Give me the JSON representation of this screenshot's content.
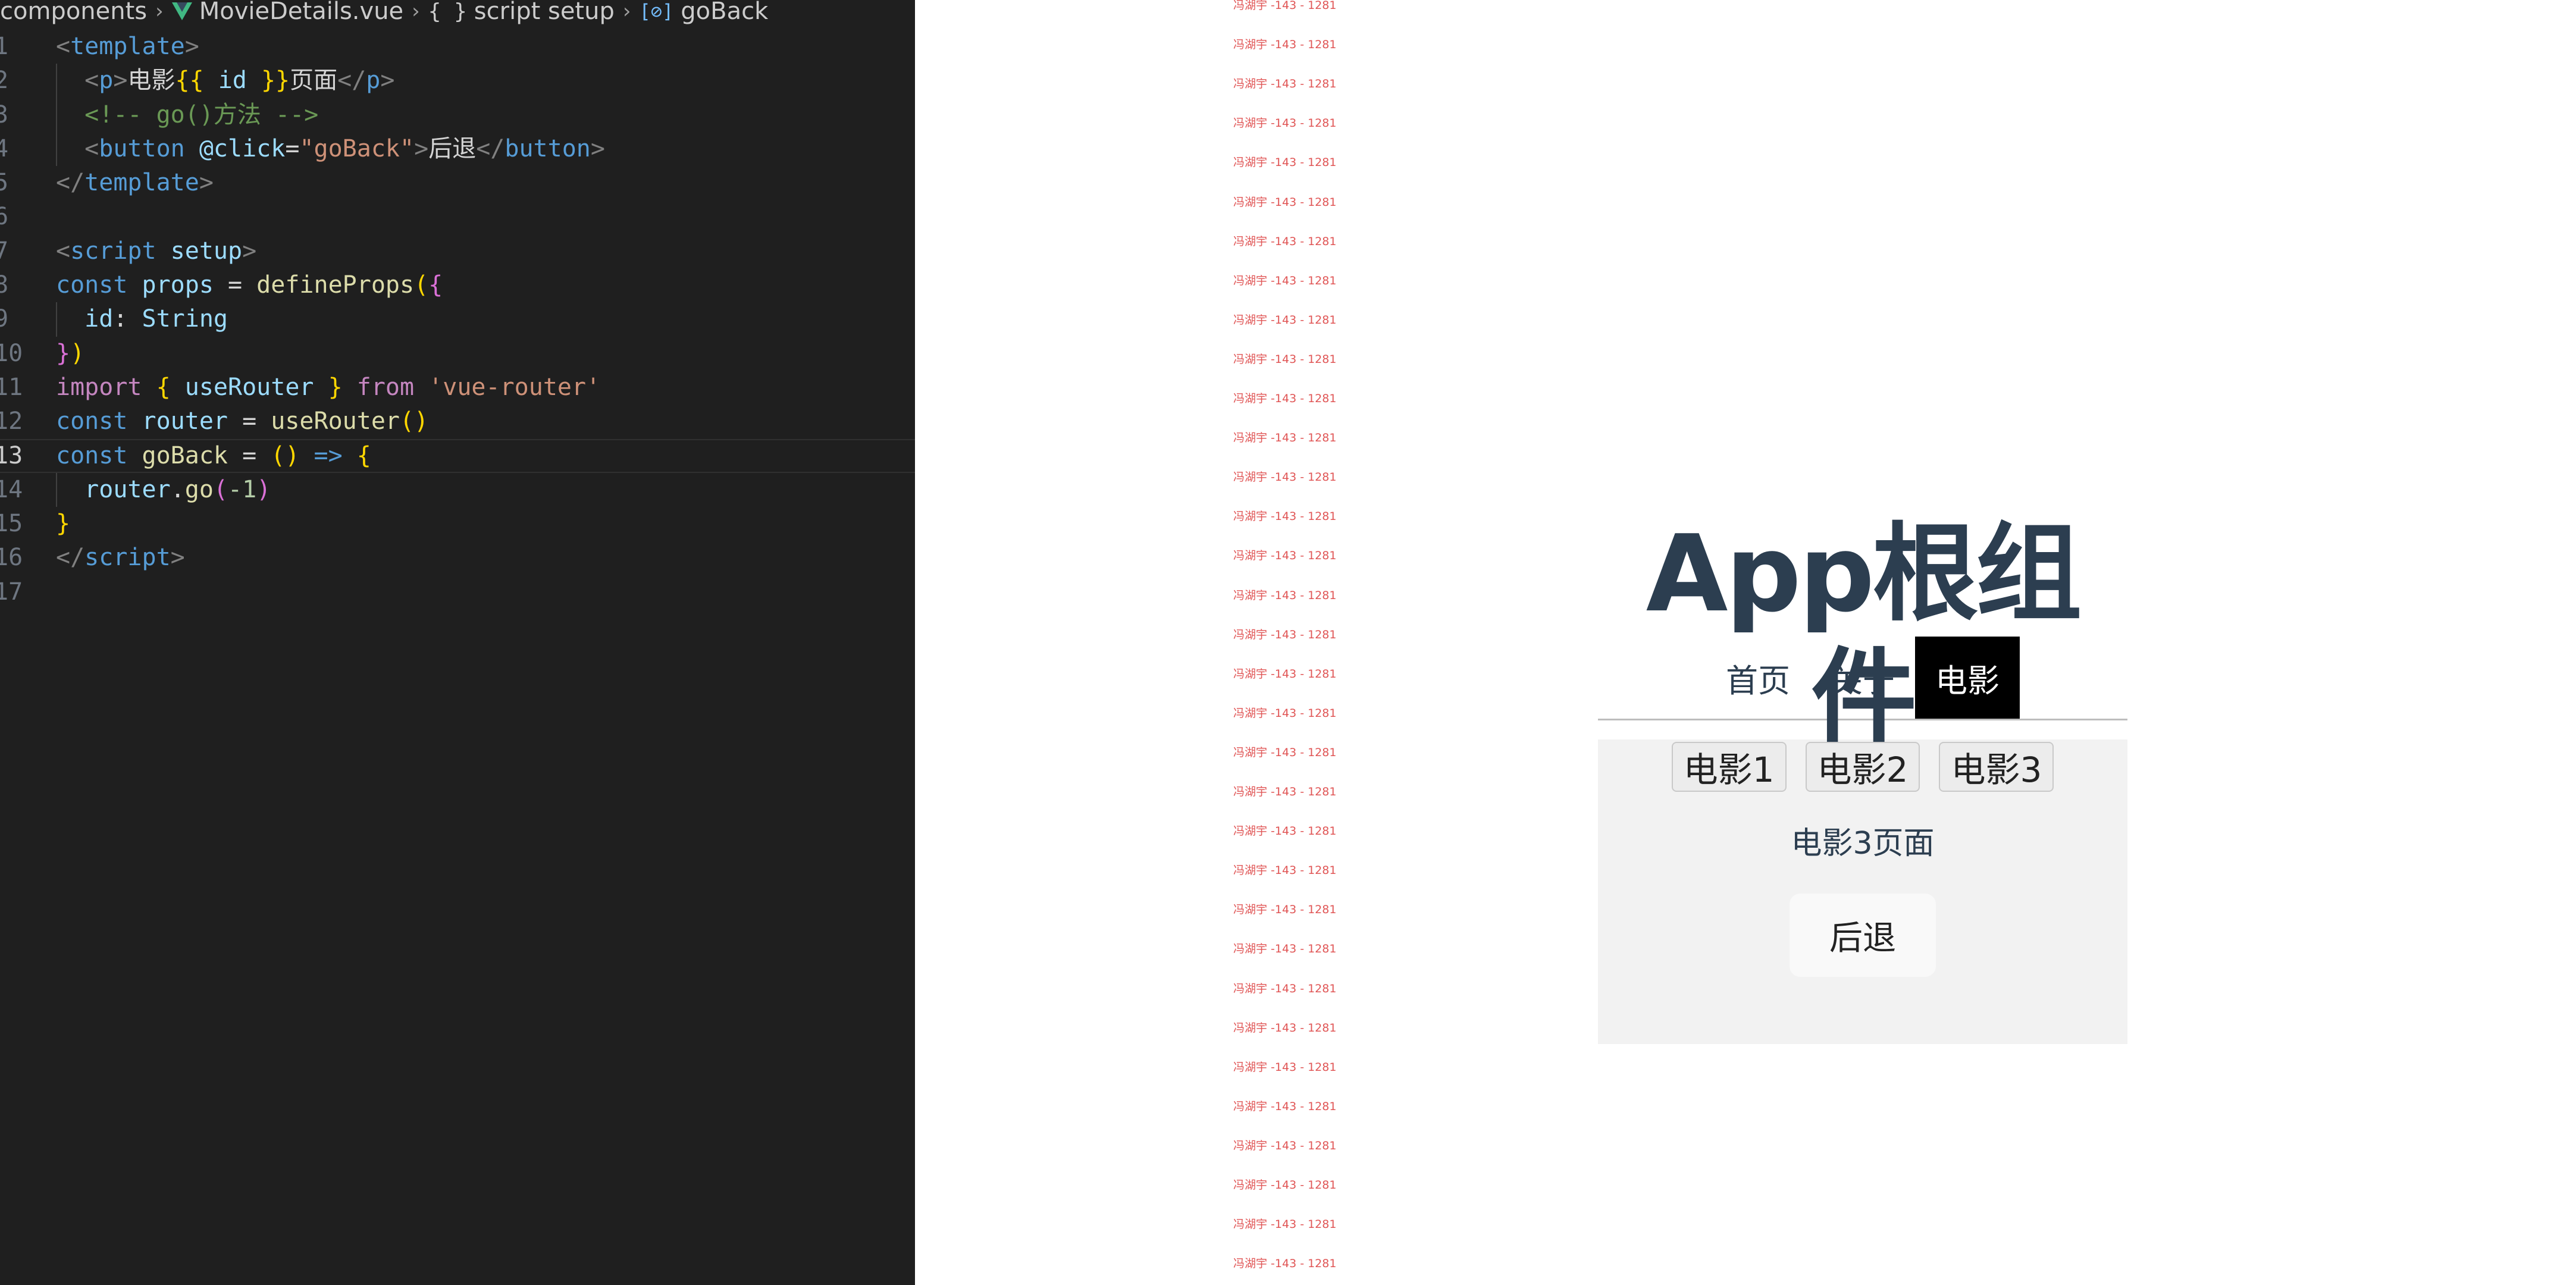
{
  "editor": {
    "breadcrumb": {
      "components": "components",
      "file": "MovieDetails.vue",
      "script_setup": "script setup",
      "symbol": "goBack",
      "braces_glyph": "{ }",
      "var_glyph": "[⊘]"
    },
    "line_numbers": [
      "1",
      "2",
      "3",
      "4",
      "5",
      "6",
      "7",
      "8",
      "9",
      "10",
      "11",
      "12",
      "13",
      "14",
      "15",
      "16",
      "17"
    ],
    "code": {
      "l1": {
        "open": "<",
        "tag": "template",
        "close": ">"
      },
      "l2": {
        "open": "<",
        "tag": "p",
        "close": ">",
        "text1": "电影",
        "must1": "{{",
        "var": " id ",
        "must2": "}}",
        "text2": "页面",
        "eopen": "</",
        "etag": "p",
        "eclose": ">"
      },
      "l3": {
        "comment": "<!-- go()方法 -->"
      },
      "l4": {
        "open": "<",
        "tag": "button",
        "attr": " @click",
        "eq": "=",
        "str": "\"goBack\"",
        "close": ">",
        "text": "后退",
        "eopen": "</",
        "etag": "button",
        "eclose": ">"
      },
      "l5": {
        "open": "</",
        "tag": "template",
        "close": ">"
      },
      "l7": {
        "open": "<",
        "tag": "script",
        "attr": " setup",
        "close": ">"
      },
      "l8": {
        "kw": "const",
        "var": " props",
        "op": " = ",
        "fn": "defineProps",
        "p1": "(",
        "b1": "{"
      },
      "l9": {
        "key": "id",
        "colon": ": ",
        "type": "String"
      },
      "l10": {
        "b1": "}",
        "p1": ")"
      },
      "l11": {
        "kw": "import",
        "b1": " { ",
        "var": "useRouter",
        "b2": " } ",
        "from": "from",
        "str": " 'vue-router'"
      },
      "l12": {
        "kw": "const",
        "var": " router",
        "op": " = ",
        "fn": "useRouter",
        "p1": "()"
      },
      "l13": {
        "kw": "const",
        "var": " goBack",
        "op": " = ",
        "p1": "()",
        "arrow": " => ",
        "b1": "{"
      },
      "l14": {
        "var": "router",
        "dot": ".",
        "fn": "go",
        "p1": "(",
        "num": "-1",
        "p2": ")"
      },
      "l15": {
        "b1": "}"
      },
      "l16": {
        "open": "</",
        "tag": "script",
        "close": ">"
      }
    }
  },
  "browser": {
    "watermark_text": "冯湖宇 -143 - 1281",
    "app_title": "App根组件",
    "nav": [
      {
        "label": "首页",
        "active": false
      },
      {
        "label": "关于",
        "active": false
      },
      {
        "label": "电影",
        "active": true
      }
    ],
    "movie_buttons": [
      "电影1",
      "电影2",
      "电影3"
    ],
    "detail_text": "电影3页面",
    "back_label": "后退",
    "colors": {
      "title": "#2c3e50",
      "nav_active_bg": "#000000",
      "panel_bg": "#f2f2f2",
      "watermark": "#e05555"
    }
  }
}
